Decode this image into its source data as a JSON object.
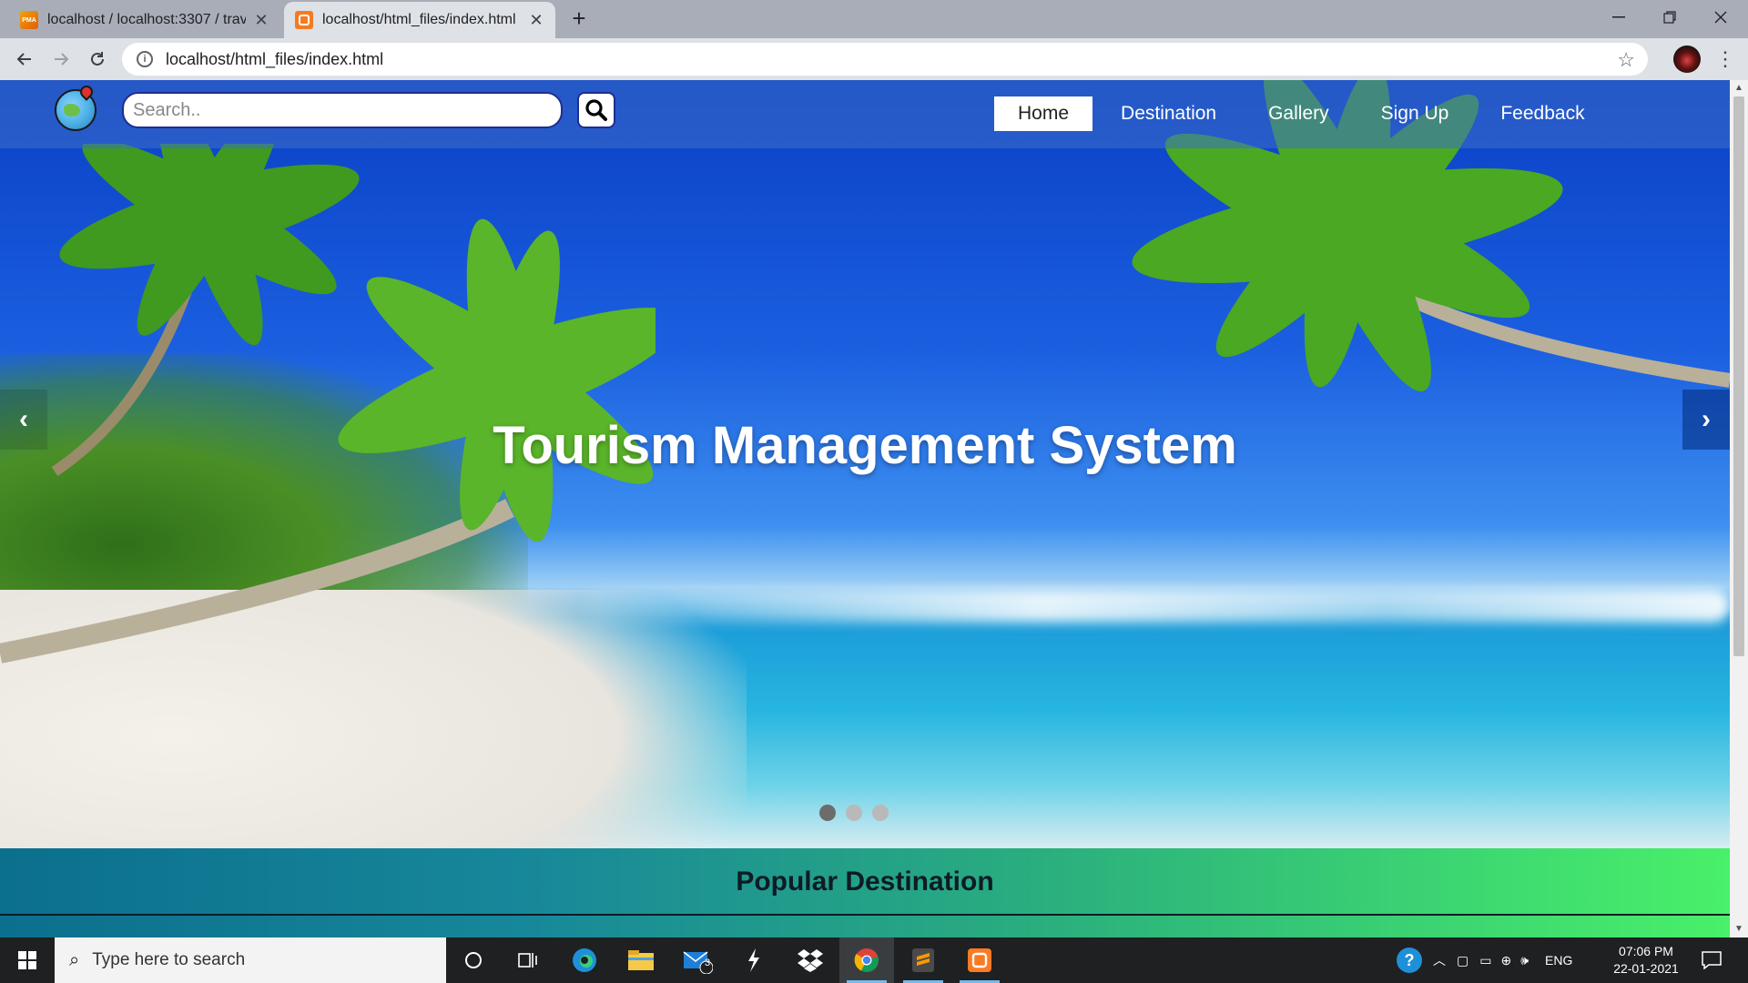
{
  "browser": {
    "tabs": [
      {
        "favicon": "pma",
        "title": "localhost / localhost:3307 / trave"
      },
      {
        "favicon": "xampp-icon",
        "title": "localhost/html_files/index.html"
      }
    ],
    "url": "localhost/html_files/index.html"
  },
  "site": {
    "search_placeholder": "Search..",
    "nav": [
      {
        "label": "Home",
        "active": true
      },
      {
        "label": "Destination",
        "active": false
      },
      {
        "label": "Gallery",
        "active": false
      },
      {
        "label": "Sign Up",
        "active": false
      },
      {
        "label": "Feedback",
        "active": false
      }
    ],
    "hero": {
      "title": "Tourism Management System",
      "prev": "‹",
      "next": "›",
      "slides": 3,
      "active_slide": 1
    },
    "section_title": "Popular Destination"
  },
  "taskbar": {
    "search_placeholder": "Type here to search",
    "mail_badge": "3",
    "language": "ENG",
    "time": "07:06 PM",
    "date": "22-01-2021"
  }
}
